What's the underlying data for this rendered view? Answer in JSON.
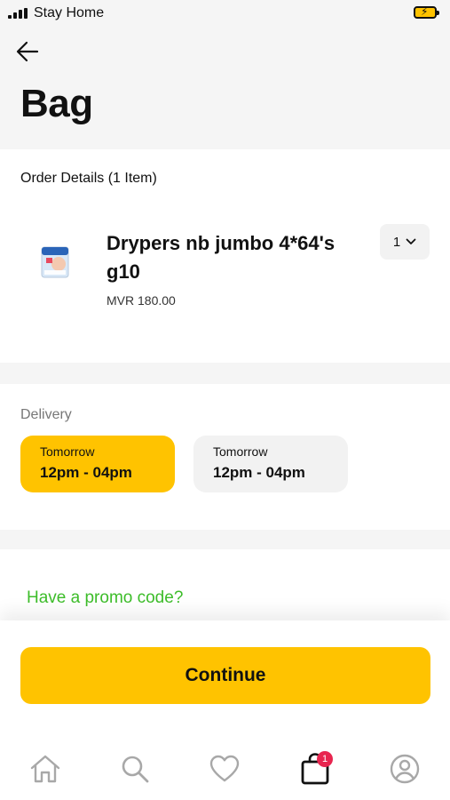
{
  "status_bar": {
    "carrier": "Stay Home",
    "battery_color": "#ffc300"
  },
  "header": {
    "title": "Bag"
  },
  "order": {
    "heading": "Order Details (1 Item)",
    "items": [
      {
        "name": "Drypers nb jumbo 4*64's g10",
        "price": "MVR 180.00",
        "quantity": "1"
      }
    ]
  },
  "delivery": {
    "label": "Delivery",
    "slots": [
      {
        "day": "Tomorrow",
        "time": "12pm - 04pm",
        "selected": true
      },
      {
        "day": "Tomorrow",
        "time": "12pm - 04pm",
        "selected": false
      }
    ]
  },
  "promo": {
    "link": "Have a promo code?"
  },
  "actions": {
    "continue_label": "Continue"
  },
  "tab_bar": {
    "tabs": [
      {
        "icon": "home-icon"
      },
      {
        "icon": "search-icon"
      },
      {
        "icon": "heart-icon"
      },
      {
        "icon": "bag-icon",
        "badge": "1",
        "active": true
      },
      {
        "icon": "profile-icon"
      }
    ]
  },
  "colors": {
    "accent": "#ffc300",
    "promo_green": "#3dbd2a",
    "badge_red": "#e8254f"
  }
}
